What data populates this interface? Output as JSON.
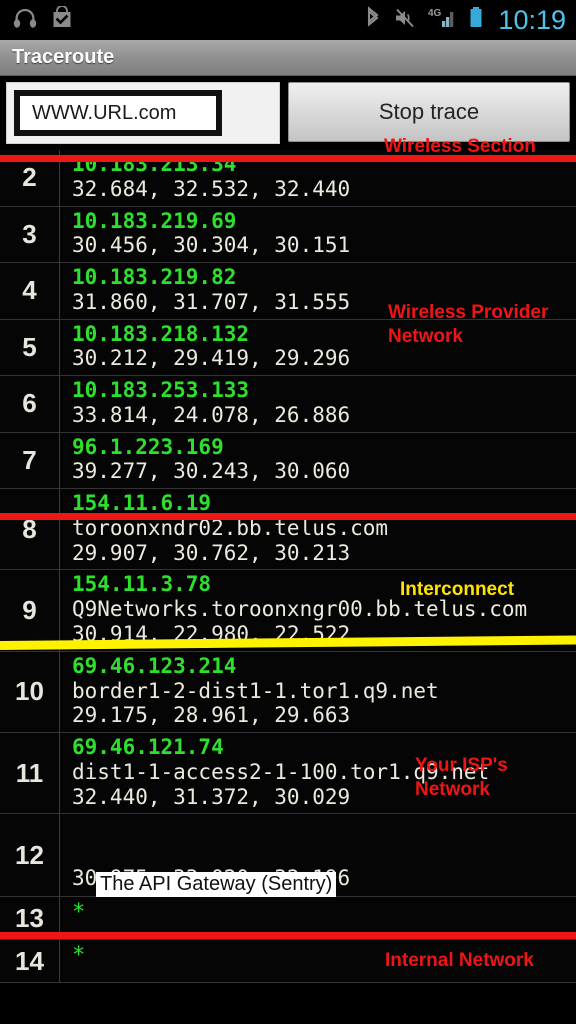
{
  "statusbar": {
    "icons_left": [
      "headphones-icon",
      "play-store-bag-icon"
    ],
    "icons_right": [
      "bluetooth-icon",
      "volume-muted-icon",
      "signal-4g-icon",
      "battery-icon"
    ],
    "network_label": "4G",
    "clock": "10:19"
  },
  "titlebar": {
    "title": "Traceroute"
  },
  "controls": {
    "url_value": "WWW.URL.com",
    "url_placeholder": "WWW.URL.com",
    "stop_label": "Stop trace"
  },
  "colors": {
    "ip_green": "#2ee02e",
    "annotation_red": "#f01515",
    "annotation_yellow": "#ffe400",
    "clock_blue": "#4fc3e8",
    "text_white": "#eceade"
  },
  "hops": [
    {
      "num": "2",
      "ip": "10.183.213.34",
      "host": "",
      "times": "32.684, 32.532, 32.440"
    },
    {
      "num": "3",
      "ip": "10.183.219.69",
      "host": "",
      "times": "30.456, 30.304, 30.151"
    },
    {
      "num": "4",
      "ip": "10.183.219.82",
      "host": "",
      "times": "31.860, 31.707, 31.555"
    },
    {
      "num": "5",
      "ip": "10.183.218.132",
      "host": "",
      "times": "30.212, 29.419, 29.296"
    },
    {
      "num": "6",
      "ip": "10.183.253.133",
      "host": "",
      "times": "33.814, 24.078, 26.886"
    },
    {
      "num": "7",
      "ip": "96.1.223.169",
      "host": "",
      "times": "39.277, 30.243, 30.060"
    },
    {
      "num": "8",
      "ip": "154.11.6.19",
      "host": "toroonxndr02.bb.telus.com",
      "times": "29.907, 30.762, 30.213"
    },
    {
      "num": "9",
      "ip": "154.11.3.78",
      "host": "Q9Networks.toroonxngr00.bb.telus.com",
      "times": "30.914, 22.980, 22.522"
    },
    {
      "num": "10",
      "ip": "69.46.123.214",
      "host": "border1-2-dist1-1.tor1.q9.net",
      "times": "29.175, 28.961, 29.663"
    },
    {
      "num": "11",
      "ip": "69.46.121.74",
      "host": "dist1-1-access2-1-100.tor1.q9.net",
      "times": "32.440, 31.372, 30.029"
    },
    {
      "num": "12",
      "ip": "",
      "host": "",
      "times": "30.975, 33.020, 32.196"
    },
    {
      "num": "13",
      "ip": "*",
      "host": "",
      "times": ""
    },
    {
      "num": "14",
      "ip": "*",
      "host": "",
      "times": ""
    }
  ],
  "annotations": {
    "wireless_section": "Wireless Section",
    "wireless_provider_network": "Wireless Provider\nNetwork",
    "interconnect": "Interconnect",
    "your_isp_network": "Your ISP's\nNetwork",
    "internal_network": "Internal Network",
    "redaction_hop12": "The API Gateway (Sentry)"
  }
}
